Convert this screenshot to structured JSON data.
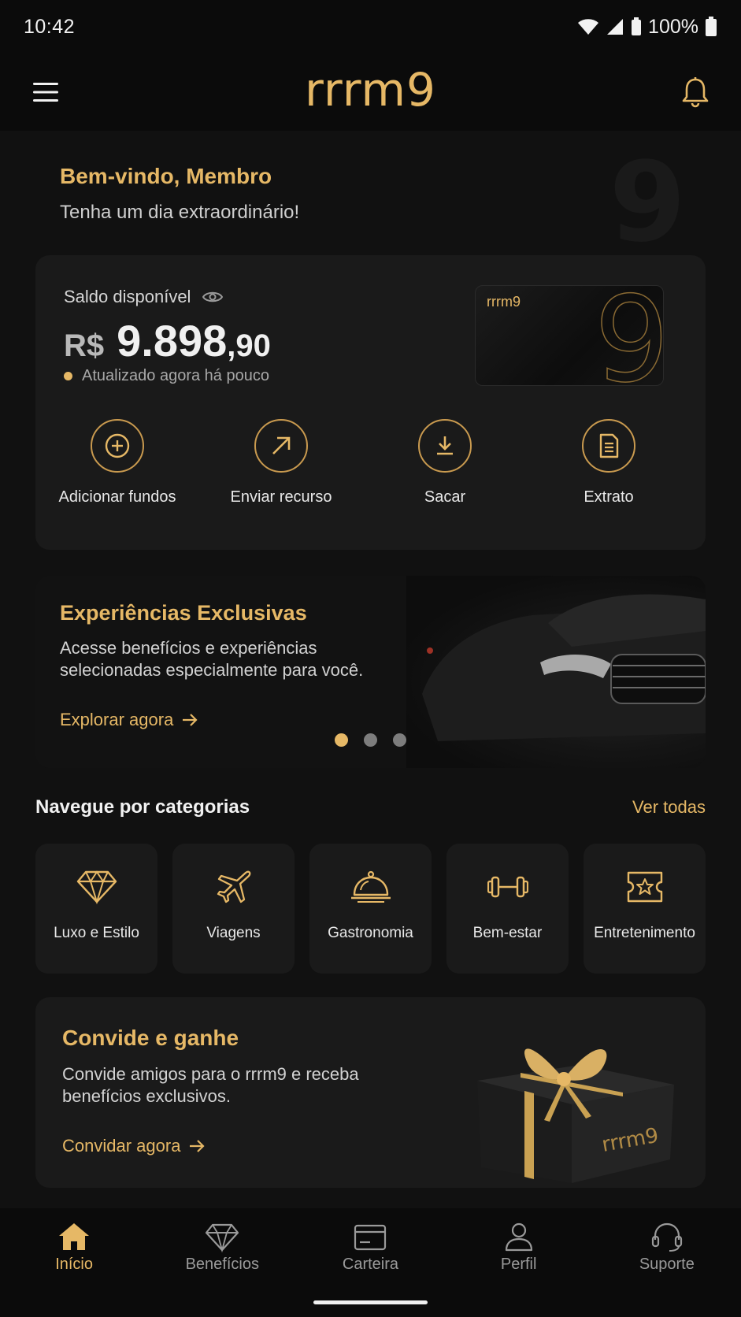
{
  "status_bar": {
    "time": "10:42",
    "battery": "100%"
  },
  "app": {
    "logo": "rrrm9"
  },
  "welcome": {
    "title": "Bem-vindo, Membro",
    "subtitle": "Tenha um dia extraordinário!"
  },
  "balance": {
    "label": "Saldo disponível",
    "currency": "R$",
    "amount": "9.898",
    "cents": ",90",
    "updated": "Atualizado agora há pouco",
    "card_logo": "rrrm9"
  },
  "actions": [
    {
      "label": "Adicionar fundos",
      "icon": "plus-circle-icon"
    },
    {
      "label": "Enviar recurso",
      "icon": "arrow-up-right-icon"
    },
    {
      "label": "Sacar",
      "icon": "download-icon"
    },
    {
      "label": "Extrato",
      "icon": "document-icon"
    }
  ],
  "promo": {
    "title": "Experiências Exclusivas",
    "text": "Acesse benefícios e experiências selecionadas especialmente para você.",
    "cta": "Explorar agora",
    "active_slide": 1,
    "slides": 3
  },
  "categories_section": {
    "title": "Navegue por categorias",
    "see_all": "Ver todas"
  },
  "categories": [
    {
      "label": "Luxo e Estilo",
      "icon": "diamond-icon"
    },
    {
      "label": "Viagens",
      "icon": "airplane-icon"
    },
    {
      "label": "Gastronomia",
      "icon": "cloche-icon"
    },
    {
      "label": "Bem-estar",
      "icon": "dumbbell-icon"
    },
    {
      "label": "Entretenimento",
      "icon": "ticket-star-icon"
    }
  ],
  "invite": {
    "title": "Convide e ganhe",
    "text": "Convide amigos para o rrrm9 e receba benefícios exclusivos.",
    "cta": "Convidar agora",
    "gift_logo": "rrrm9"
  },
  "bottom_nav": [
    {
      "label": "Início",
      "icon": "home-icon",
      "active": true
    },
    {
      "label": "Benefícios",
      "icon": "diamond-icon",
      "active": false
    },
    {
      "label": "Carteira",
      "icon": "wallet-card-icon",
      "active": false
    },
    {
      "label": "Perfil",
      "icon": "user-icon",
      "active": false
    },
    {
      "label": "Suporte",
      "icon": "headset-icon",
      "active": false
    }
  ],
  "colors": {
    "accent": "#e6b866",
    "background": "#111111",
    "card": "#1a1a1a"
  }
}
